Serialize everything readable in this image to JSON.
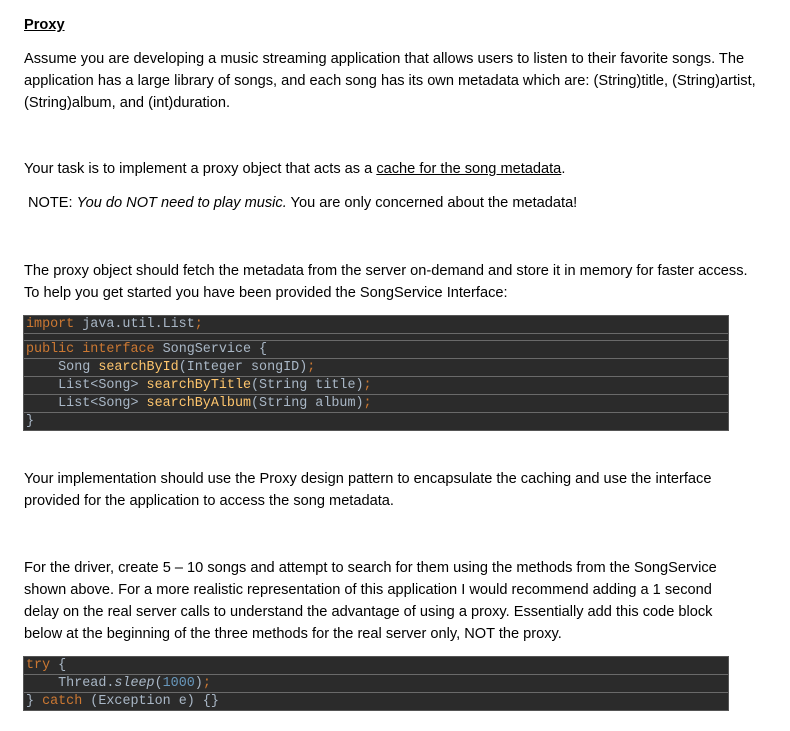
{
  "heading": "Proxy",
  "intro": "Assume you are developing a music streaming application that allows users to listen to their favorite songs. The application has a large library of songs, and each song has its own metadata which are: (String)title, (String)artist, (String)album, and (int)duration.",
  "task_prefix": "Your task is to implement a proxy object that acts as a ",
  "task_link": "cache for the song metadata",
  "task_suffix": ".",
  "note_label": "NOTE: ",
  "note_italic": "You do NOT need to play music.",
  "note_rest": " You are only concerned about the metadata!",
  "proxy_paragraph": "The proxy object should fetch the metadata from the server on-demand and store it in memory for faster access. To help you get started you have been provided the SongService Interface:",
  "code1": {
    "import_kw": "import",
    "import_rest": " java.util.List",
    "semi": ";",
    "public_kw": "public",
    "interface_kw": "interface",
    "iface_name": " SongService {",
    "m1_ret": "    Song ",
    "m1_name": "searchById",
    "m1_params": "(Integer songID)",
    "m2_ret": "    List<Song> ",
    "m2_name": "searchByTitle",
    "m2_params": "(String title)",
    "m3_ret": "    List<Song> ",
    "m3_name": "searchByAlbum",
    "m3_params": "(String album)",
    "close": "}"
  },
  "impl_paragraph": "Your implementation should use the Proxy design pattern to encapsulate the caching and use the interface provided for the application to access the song metadata.",
  "driver_paragraph": "For the driver, create 5 – 10 songs and attempt to search for them using the methods from the SongService shown above. For a more realistic representation of this application I would recommend adding a 1 second delay on the real server calls to understand the advantage of using a proxy. Essentially add this code block below at the beginning of the three methods for the real server only, NOT the proxy.",
  "code2": {
    "try_kw": "try",
    "try_rest": " {",
    "sleep_prefix": "    Thread.",
    "sleep_name": "sleep",
    "paren_open": "(",
    "sleep_value": "1000",
    "paren_close": ")",
    "semi": ";",
    "close_prefix": "} ",
    "catch_kw": "catch",
    "catch_rest": " (Exception e) {}"
  }
}
